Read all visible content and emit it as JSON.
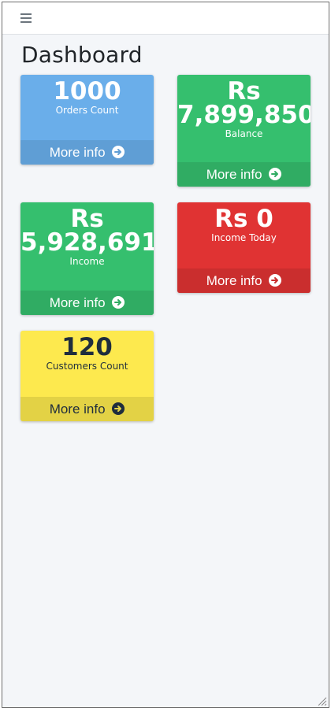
{
  "page": {
    "title": "Dashboard"
  },
  "icons": {
    "menu": "hamburger-icon",
    "arrow": "arrow-circle-right-icon",
    "resize": "resize-grip-icon"
  },
  "colors": {
    "blue": "#6aaeea",
    "green": "#35bf6e",
    "red": "#e03333",
    "yellow": "#fde94e",
    "background": "#f4f6f9"
  },
  "cards": [
    {
      "value_line1": "1000",
      "value_line2": "",
      "label": "Orders Count",
      "link": "More info"
    },
    {
      "value_line1": "Rs",
      "value_line2": "7,899,850",
      "label": "Balance",
      "link": "More info"
    },
    {
      "value_line1": "Rs",
      "value_line2": "5,928,691",
      "label": "Income",
      "link": "More info"
    },
    {
      "value_line1": "Rs 0",
      "value_line2": "",
      "label": "Income Today",
      "link": "More info"
    },
    {
      "value_line1": "120",
      "value_line2": "",
      "label": "Customers Count",
      "link": "More info"
    }
  ]
}
